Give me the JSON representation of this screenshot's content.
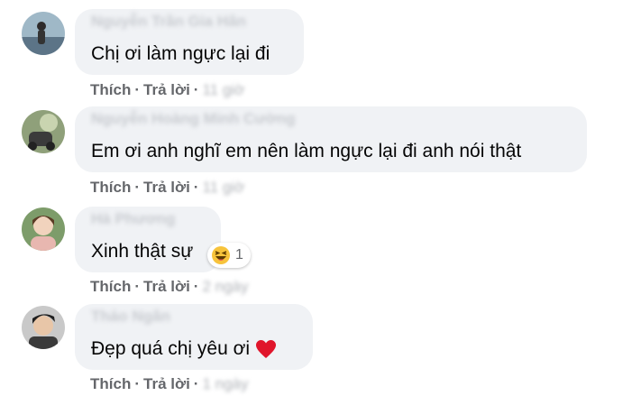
{
  "actions": {
    "like": "Thích",
    "reply": "Trả lời"
  },
  "comments": [
    {
      "author": "Nguyễn Trần Gia Hân",
      "text": "Chị ơi làm ngực lại đi",
      "time": "11 giờ"
    },
    {
      "author": "Nguyễn Hoàng Minh Cường",
      "text": "Em ơi anh nghĩ em nên làm ngực lại đi anh nói thật",
      "time": "11 giờ"
    },
    {
      "author": "Hà Phương",
      "text": "Xinh thật sự",
      "time": "2 ngày",
      "reaction": {
        "icon": "haha-emoji-icon",
        "count": "1"
      }
    },
    {
      "author": "Thảo Ngân",
      "text": "Đẹp quá chị yêu ơi",
      "time": "1 ngày",
      "emoji": "heart-icon"
    }
  ],
  "colors": {
    "bubble": "#f0f2f5",
    "action": "#65676b",
    "text": "#050505",
    "heart": "#e0152b"
  }
}
